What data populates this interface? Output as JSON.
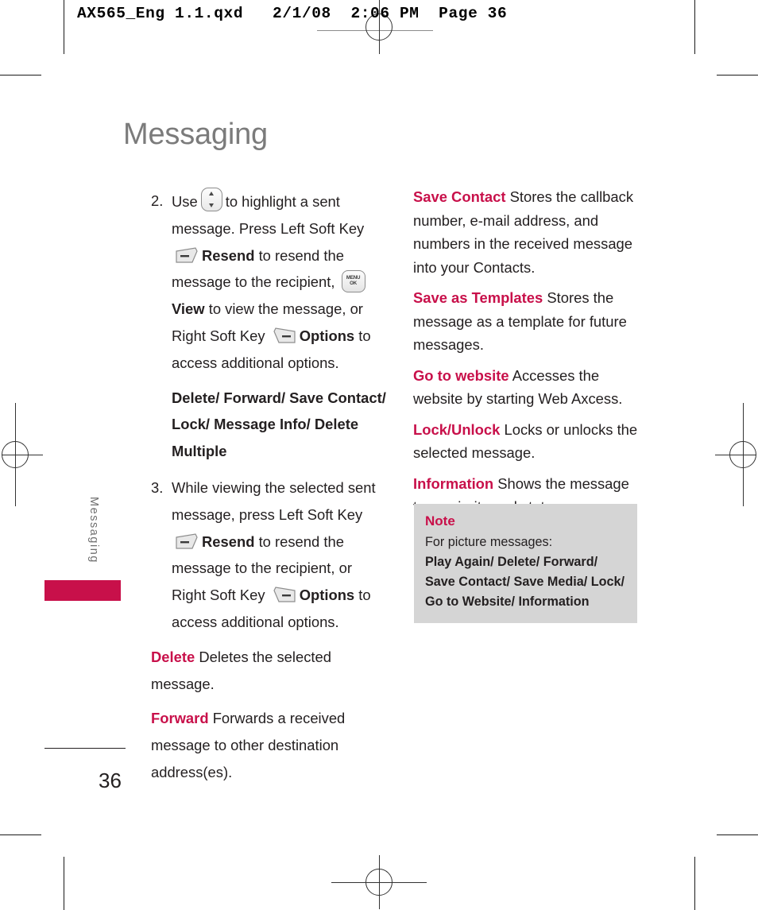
{
  "printer_slug": "AX565_Eng 1.1.qxd   2/1/08  2:06 PM  Page 36",
  "page": {
    "title": "Messaging",
    "folio": "36",
    "side_tab_label": "Messaging",
    "accent_color": "#c8104a",
    "title_color": "#7b7b7b"
  },
  "left_column": {
    "step2": {
      "number": "2.",
      "t1": "Use",
      "icon1": "nav-key-icon",
      "t2": "to highlight a sent message. Press Left Soft Key",
      "icon2": "left-soft-key-icon",
      "b1": "Resend",
      "t3": "to resend the message to the recipient,",
      "icon3": "menu-ok-key-icon",
      "b2": "View",
      "t4": "to view the message, or Right Soft Key",
      "icon4": "right-soft-key-icon",
      "b3": "Options",
      "t5": "to access additional options."
    },
    "options_list": "Delete/ Forward/ Save Contact/ Lock/ Message Info/ Delete Multiple",
    "step3": {
      "number": "3.",
      "t1": "While viewing the selected sent message, press Left Soft Key",
      "icon1": "left-soft-key-icon",
      "b1": "Resend",
      "t2": "to resend the message to the recipient, or Right Soft Key",
      "icon2": "right-soft-key-icon",
      "b2": "Options",
      "t3": "to access additional options."
    },
    "definitions": [
      {
        "term": "Delete",
        "text": "Deletes the selected message."
      },
      {
        "term": "Forward",
        "text": "Forwards a received message to other destination address(es)."
      }
    ]
  },
  "right_column": {
    "definitions": [
      {
        "term": "Save Contact",
        "text": "Stores the callback number, e-mail address, and numbers in the received message into your Contacts."
      },
      {
        "term": "Save as Templates",
        "text": "Stores the message as a template for future messages."
      },
      {
        "term": "Go to website",
        "text": "Accesses the website by starting Web Axcess."
      },
      {
        "term": "Lock/Unlock",
        "text": "Locks or unlocks the selected message."
      },
      {
        "term": "Information",
        "text": "Shows the message type priority and status."
      }
    ],
    "note": {
      "title": "Note",
      "lead": "For picture messages:",
      "line1": "Play Again/ Delete/ Forward/",
      "line2": "Save Contact/ Save Media/ Lock/",
      "line3": "Go to Website/ Information"
    }
  },
  "icons": {
    "menu_key_line1": "MENU",
    "menu_key_line2": "OK"
  }
}
